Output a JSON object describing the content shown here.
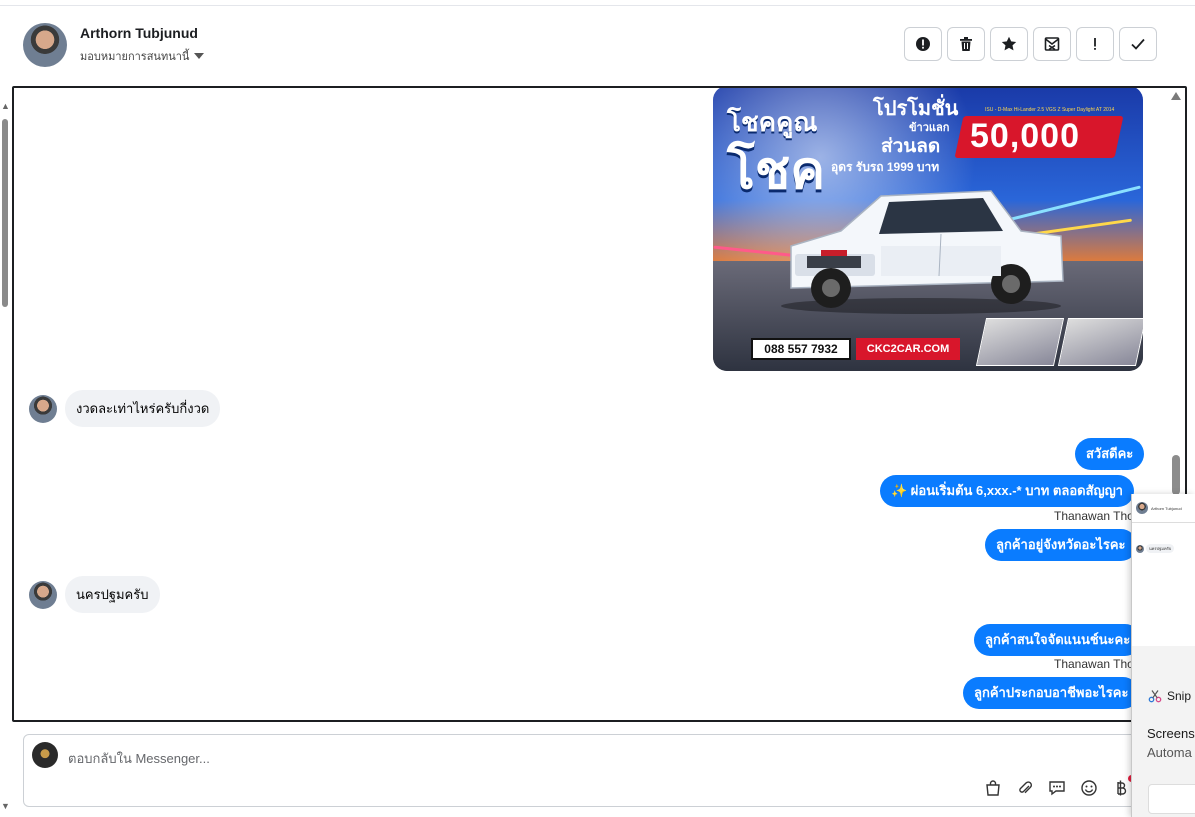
{
  "contact": {
    "name": "Arthorn Tubjunud",
    "assign_label": "มอบหมายการสนทนานี้"
  },
  "header_actions": [
    {
      "name": "spam-button",
      "icon": "alert-circle-icon"
    },
    {
      "name": "delete-button",
      "icon": "trash-icon"
    },
    {
      "name": "star-button",
      "icon": "star-icon"
    },
    {
      "name": "mark-unread-button",
      "icon": "envelope-x-icon"
    },
    {
      "name": "follow-up-button",
      "icon": "exclamation-icon"
    },
    {
      "name": "done-button",
      "icon": "check-icon"
    }
  ],
  "promo_image": {
    "headline_1": "โชคคูณ",
    "headline_2": "โชค",
    "promo_label": "โปรโมชั่น",
    "trade_in_label": "ข้าวแลก",
    "discount_label": "ส่วนลด",
    "discount_amount": "50,000",
    "sub_label": "อุดร รับรถ 1999 บาท",
    "fine_print": "ISU - D-Max Hi-Lander 2.5 VGS Z Super Daylight AT 2014",
    "phone": "088 557 7932",
    "website": "CKC2CAR.COM"
  },
  "messages": {
    "in_1": "งวดละเท่าไหร่ครับกี่งวด",
    "out_1": "สวัสดีคะ",
    "out_2": "✨ ผ่อนเริ่มต้น 6,xxx.-* บาท ตลอดสัญญา",
    "sender_1": "Thanawan Tho",
    "out_3": "ลูกค้าอยู่จังหวัดอะไรคะ",
    "in_2": "นครปฐมครับ",
    "out_4": "ลูกค้าสนใจจัดแนนช์นะคะ",
    "sender_2": "Thanawan Tho",
    "out_5": "ลูกค้าประกอบอาชีพอะไรคะ"
  },
  "composer": {
    "placeholder": "ตอบกลับใน Messenger...",
    "tools": [
      "bag-icon",
      "paperclip-icon",
      "chat-bubble-icon",
      "emoji-icon",
      "baht-icon"
    ]
  },
  "snip_overlay": {
    "mini_name": "Arthorn Tubjunud",
    "mini_msg": "นครปฐมครับ",
    "brand": "Snip",
    "title": "Screens",
    "subtitle": "Automa"
  },
  "colors": {
    "accent": "#0a7cff",
    "incoming_bubble": "#f0f2f5",
    "promo_red": "#d8162b"
  }
}
